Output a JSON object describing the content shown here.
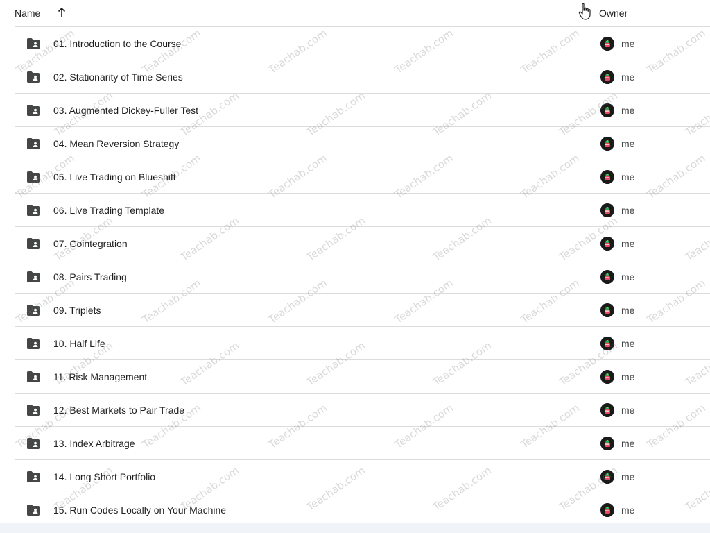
{
  "header": {
    "name_label": "Name",
    "owner_label": "Owner",
    "sort_direction": "ascending"
  },
  "rows": [
    {
      "name": "01. Introduction to the Course",
      "owner": "me"
    },
    {
      "name": "02. Stationarity of Time Series",
      "owner": "me"
    },
    {
      "name": "03. Augmented Dickey-Fuller Test",
      "owner": "me"
    },
    {
      "name": "04. Mean Reversion Strategy",
      "owner": "me"
    },
    {
      "name": "05. Live Trading on Blueshift",
      "owner": "me"
    },
    {
      "name": "06. Live Trading Template",
      "owner": "me"
    },
    {
      "name": "07. Cointegration",
      "owner": "me"
    },
    {
      "name": "08. Pairs Trading",
      "owner": "me"
    },
    {
      "name": "09. Triplets",
      "owner": "me"
    },
    {
      "name": "10. Half Life",
      "owner": "me"
    },
    {
      "name": "11. Risk Management",
      "owner": "me"
    },
    {
      "name": "12. Best Markets to Pair Trade",
      "owner": "me"
    },
    {
      "name": "13. Index Arbitrage",
      "owner": "me"
    },
    {
      "name": "14. Long Short Portfolio",
      "owner": "me"
    },
    {
      "name": "15. Run Codes Locally on Your Machine",
      "owner": "me"
    }
  ],
  "watermark": "Teachab.com",
  "icons": {
    "sort": "arrow-up-icon",
    "folder": "shared-folder-icon",
    "avatar": "user-avatar",
    "cursor": "hand-pointer-cursor-icon"
  },
  "colors": {
    "text": "#1f1f1f",
    "divider": "#dadce0",
    "folder": "#444746"
  }
}
